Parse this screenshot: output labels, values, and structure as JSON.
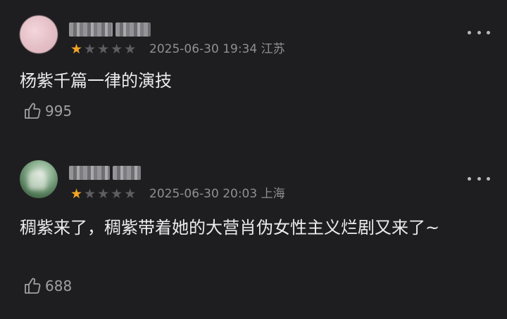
{
  "reviews": [
    {
      "rating": 1,
      "date": "2025-06-30 19:34",
      "location": "江苏",
      "content": "杨紫千篇一律的演技",
      "likes": "995"
    },
    {
      "rating": 1,
      "date": "2025-06-30 20:03",
      "location": "上海",
      "content": "稠紫来了，稠紫带着她的大营肖伪女性主义烂剧又来了~",
      "likes": "688"
    }
  ],
  "icons": {
    "like": "thumbs-up-icon",
    "more": "more-dots-icon",
    "star": "star-icon"
  },
  "colors": {
    "background": "#1e1e21",
    "star_filled": "#f5a623",
    "star_empty": "#5d5d62",
    "meta_text": "#8f8f94"
  }
}
